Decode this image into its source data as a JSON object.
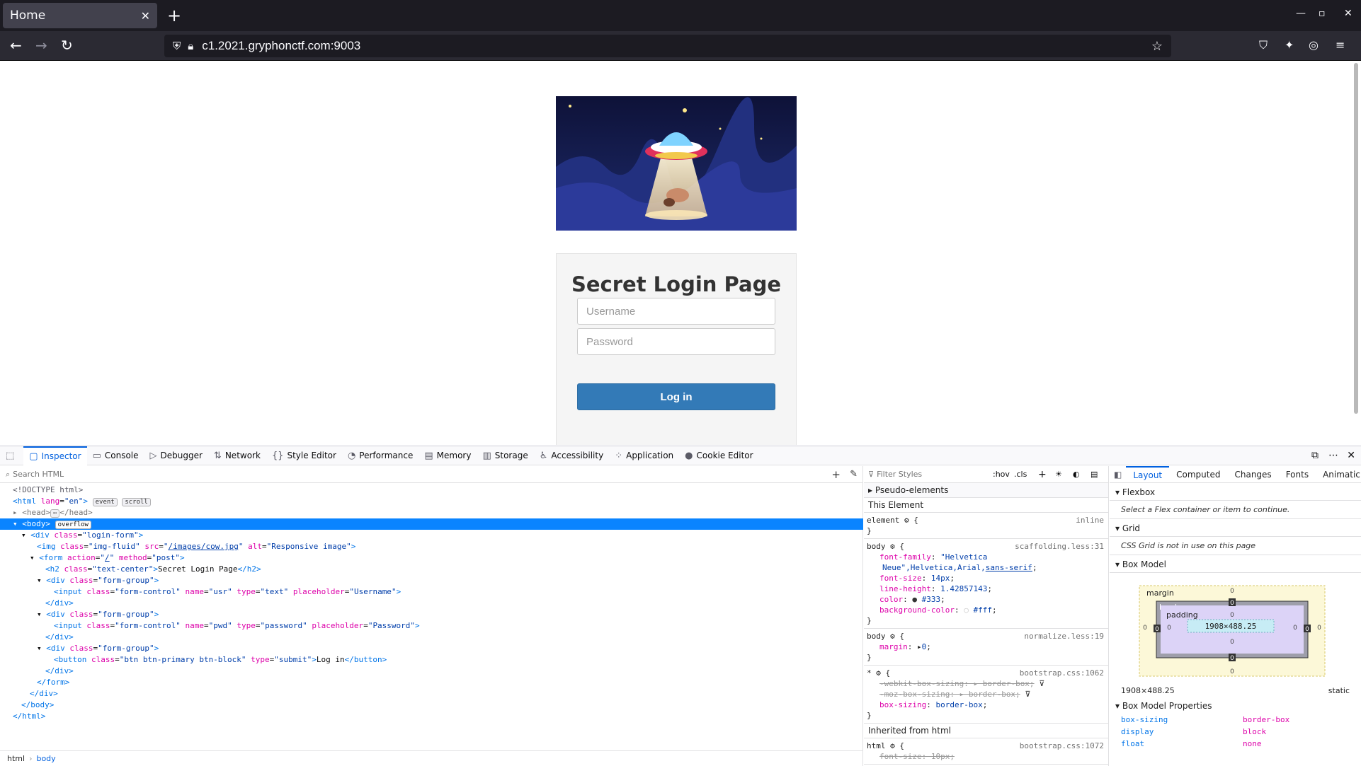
{
  "tab": {
    "title": "Home"
  },
  "url": "c1.2021.gryphonctf.com:9003",
  "page": {
    "title": "Secret Login Page",
    "username_placeholder": "Username",
    "password_placeholder": "Password",
    "login_label": "Log in"
  },
  "devtools": {
    "tabs": [
      "Inspector",
      "Console",
      "Debugger",
      "Network",
      "Style Editor",
      "Performance",
      "Memory",
      "Storage",
      "Accessibility",
      "Application",
      "Cookie Editor"
    ],
    "search_placeholder": "Search HTML",
    "markup": {
      "doctype": "<!DOCTYPE html>",
      "html_badges": [
        "event",
        "scroll"
      ],
      "body_badge": "overflow",
      "img_src": "/images/cow.jpg",
      "img_alt": "Responsive image",
      "h2_text": "Secret Login Page",
      "btn_text": "Log in"
    },
    "breadcrumbs": [
      "html",
      "body"
    ],
    "rules": {
      "filter_placeholder": "Filter Styles",
      "hov": ":hov",
      "cls": ".cls",
      "pseudo": "Pseudo-elements",
      "this_element": "This Element",
      "inherited": "Inherited from html",
      "element_src": "inline",
      "body1_src": "scaffolding.less:31",
      "body2_src": "normalize.less:19",
      "star_src": "bootstrap.css:1062",
      "html_src": "bootstrap.css:1072"
    },
    "layout": {
      "tabs": [
        "Layout",
        "Computed",
        "Changes",
        "Fonts",
        "Animatic"
      ],
      "flexbox": "Flexbox",
      "flexbox_note": "Select a Flex container or item to continue.",
      "grid": "Grid",
      "grid_note": "CSS Grid is not in use on this page",
      "box_model": "Box Model",
      "box_size": "1908×488.25",
      "position": "static",
      "props_head": "Box Model Properties",
      "props": [
        {
          "k": "box-sizing",
          "v": "border-box"
        },
        {
          "k": "display",
          "v": "block"
        },
        {
          "k": "float",
          "v": "none"
        }
      ]
    }
  }
}
